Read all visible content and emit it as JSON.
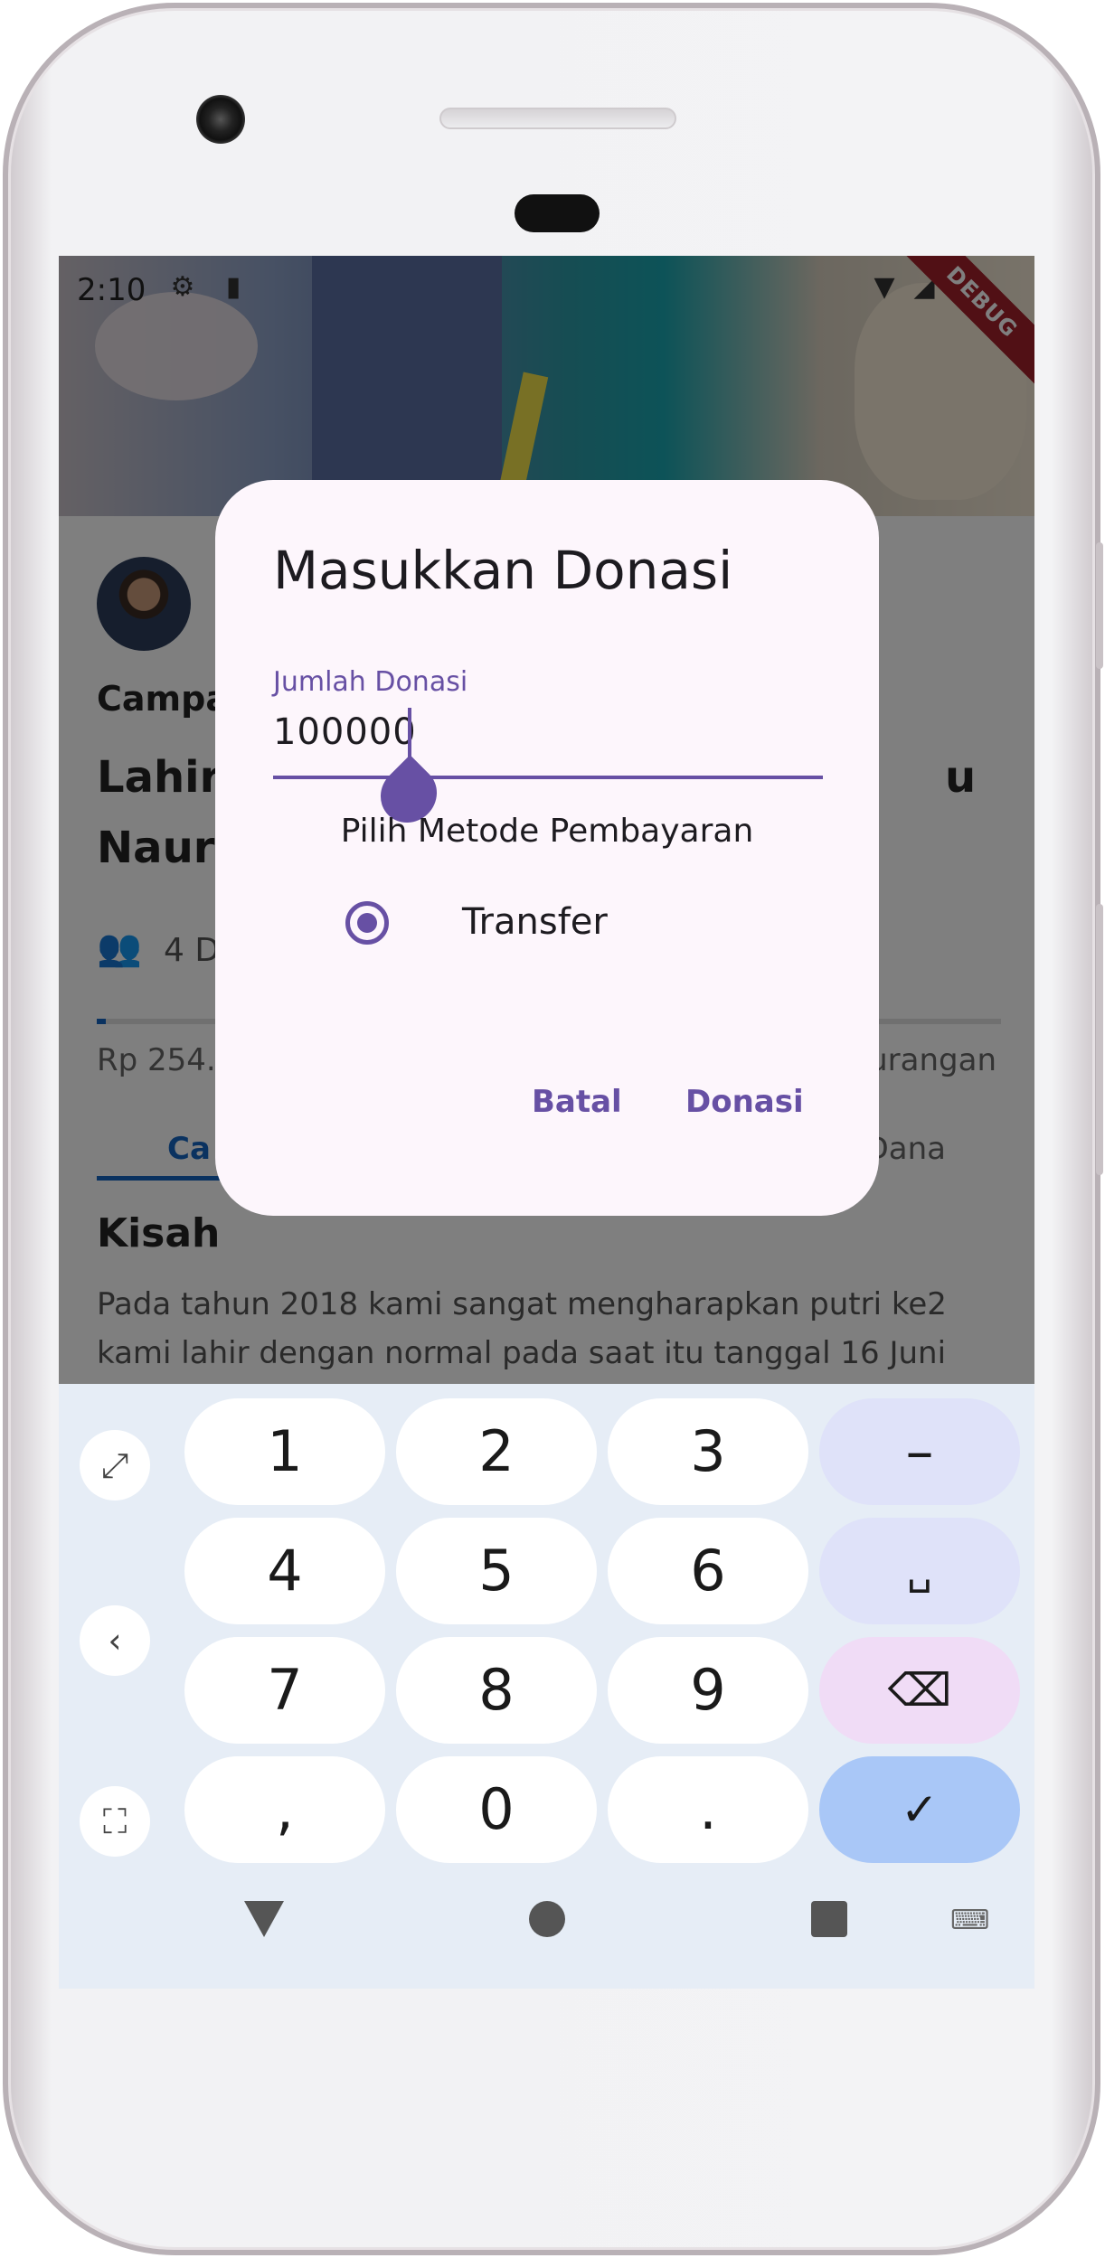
{
  "status_bar": {
    "time": "2:10",
    "debug_banner": "DEBUG"
  },
  "background_page": {
    "campaign_label": "Campa",
    "title_line1_left": "Lahir",
    "title_line1_right": "u",
    "title_line2_left": "Naura",
    "donors_count": "4 D",
    "amount_raised": "Rp 254.",
    "remaining_label": "urangan",
    "tab_left": "Ca",
    "tab_right": "Dana",
    "section_heading": "Kisah",
    "story_line1": "Pada tahun 2018 kami sangat mengharapkan putri ke2",
    "story_line2": "kami lahir dengan normal pada saat itu tanggal 16 Juni"
  },
  "dialog": {
    "title": "Masukkan Donasi",
    "amount_field": {
      "label": "Jumlah Donasi",
      "value": "100000"
    },
    "payment_method_label": "Pilih Metode Pembayaran",
    "payment_options": [
      {
        "label": "Transfer",
        "selected": true
      }
    ],
    "cancel_label": "Batal",
    "confirm_label": "Donasi",
    "accent_color": "#6750a4"
  },
  "keyboard": {
    "rows": [
      [
        "1",
        "2",
        "3",
        "–"
      ],
      [
        "4",
        "5",
        "6",
        "␣"
      ],
      [
        "7",
        "8",
        "9",
        "⌫"
      ],
      [
        ",",
        "0",
        ".",
        "✓"
      ]
    ],
    "side_keys": [
      "expand-icon",
      "chevron-left-icon",
      "resize-icon"
    ]
  },
  "navigation": {
    "buttons": [
      "back-icon",
      "home-icon",
      "recents-icon",
      "keyboard-icon"
    ]
  }
}
